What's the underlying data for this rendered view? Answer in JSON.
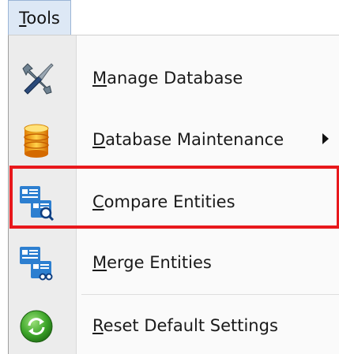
{
  "menubar": {
    "tools": {
      "accel": "T",
      "rest": "ools"
    }
  },
  "menu": {
    "items": [
      {
        "accel": "M",
        "rest": "anage Database",
        "icon": "tools-icon"
      },
      {
        "accel": "D",
        "rest": "atabase Maintenance",
        "icon": "database-icon",
        "submenu": true
      },
      {
        "accel": "C",
        "rest": "ompare Entities",
        "icon": "compare-entities-icon",
        "highlighted": true
      },
      {
        "accel": "M",
        "rest": "erge Entities",
        "icon": "merge-entities-icon"
      },
      {
        "accel": "R",
        "rest": "eset Default Settings",
        "icon": "reset-icon"
      }
    ]
  },
  "colors": {
    "highlight_border": "#e8181c",
    "menubar_active": "#dde8f5",
    "gutter": "#ececec"
  }
}
